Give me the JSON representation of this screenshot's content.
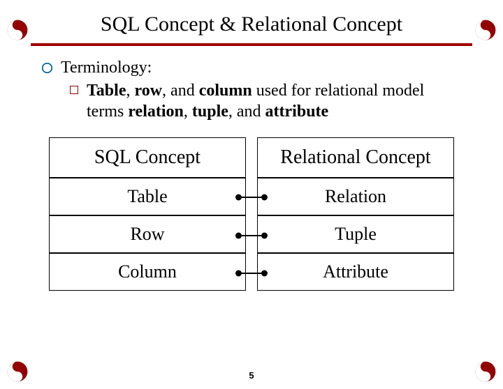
{
  "title": "SQL Concept & Relational Concept",
  "terminology_label": "Terminology:",
  "sub_bullet_html": "<b>Table</b>, <b>row</b>, and <b>column</b> used for relational model terms <b>relation</b>, <b>tuple</b>, and <b>attribute</b>",
  "table": {
    "left_header": "SQL Concept",
    "right_header": "Relational Concept",
    "rows": [
      {
        "left": "Table",
        "right": "Relation"
      },
      {
        "left": "Row",
        "right": "Tuple"
      },
      {
        "left": "Column",
        "right": "Attribute"
      }
    ]
  },
  "page_number": "5",
  "icons": {
    "corner": "yinyang-icon",
    "accent_color": "#920000"
  }
}
